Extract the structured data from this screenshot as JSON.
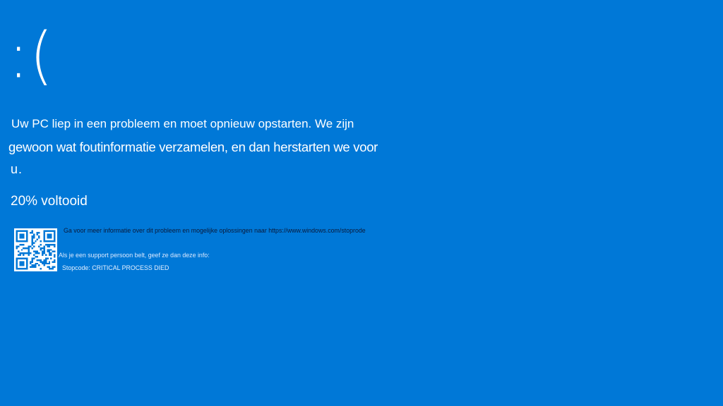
{
  "screen": {
    "sad_face": ":(",
    "message_line_1": "Uw PC liep in een probleem en moet opnieuw opstarten. We zijn",
    "message_line_2": "gewoon wat foutinformatie verzamelen, en dan herstarten we voor",
    "message_line_3": "u.",
    "progress_text": "20% voltooid",
    "progress_percent": 20,
    "info_link_text": "Ga voor meer informatie over dit probleem en mogelijke oplossingen naar https://www.windows.com/stoprode",
    "support_text": "Als je een support persoon belt, geef ze dan deze info:",
    "stopcode_text": "Stopcode: CRITICAL PROCESS DIED",
    "qr_icon": "qr-code-icon"
  },
  "colors": {
    "background": "#0078d7",
    "text": "#ffffff",
    "qr_background": "#ffffff",
    "qr_modules": "#0078d7"
  }
}
